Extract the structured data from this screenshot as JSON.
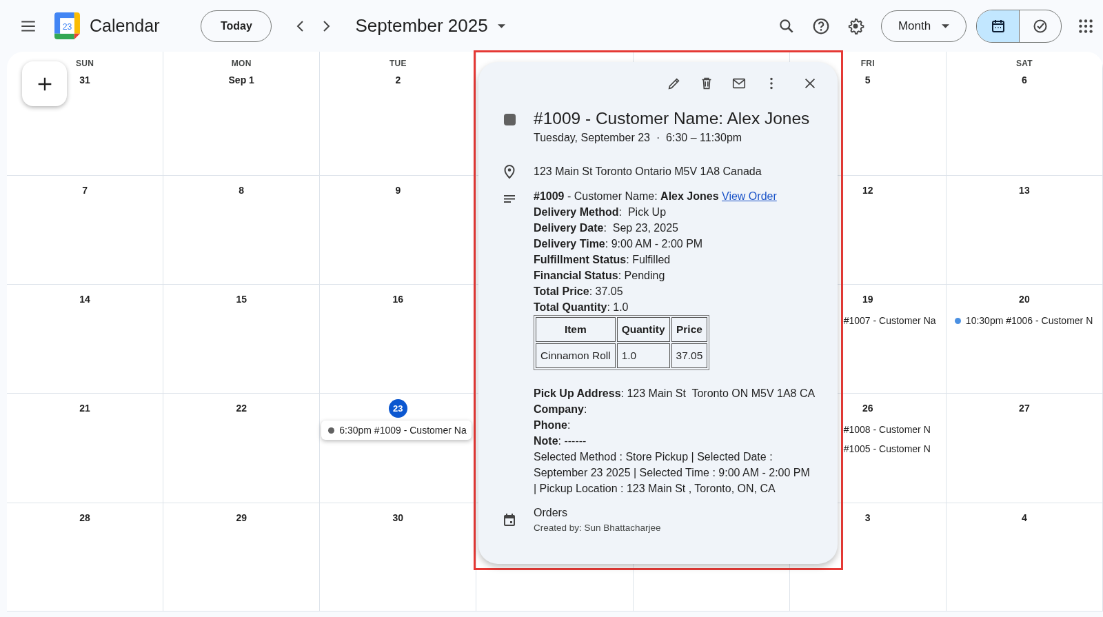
{
  "header": {
    "logo_number": "23",
    "app_title": "Calendar",
    "today_button": "Today",
    "period": "September 2025",
    "view_button": "Month",
    "actions": [
      {
        "kind": "search"
      },
      {
        "kind": "help"
      },
      {
        "kind": "settings"
      }
    ],
    "view_toggle": [
      {
        "kind": "calendar",
        "selected": true
      },
      {
        "kind": "tasks",
        "selected": false
      }
    ]
  },
  "weeks": [
    {
      "left_days": [
        {
          "weekday": "SUN",
          "date": "31"
        },
        {
          "weekday": "MON",
          "date": "Sep 1"
        },
        {
          "weekday": "TUE",
          "date": "2"
        }
      ],
      "right_days": [
        {
          "weekday": "FRI",
          "date": "5"
        },
        {
          "weekday": "SAT",
          "date": "6"
        }
      ]
    },
    {
      "left_days": [
        {
          "date": "7"
        },
        {
          "date": "8"
        },
        {
          "date": "9"
        }
      ],
      "right_days": [
        {
          "date": "12"
        },
        {
          "date": "13"
        }
      ]
    },
    {
      "left_days": [
        {
          "date": "14"
        },
        {
          "date": "15"
        },
        {
          "date": "16"
        }
      ],
      "right_days": [
        {
          "date": "19",
          "events": [
            {
              "kind": "cut",
              "selected": false,
              "text": "#1007 - Customer Na"
            }
          ]
        },
        {
          "date": "20",
          "events": [
            {
              "kind": "dot",
              "selected": false,
              "color": "#4a90e2",
              "time": "10:30pm",
              "text": "#1006 - Customer N"
            }
          ]
        }
      ]
    },
    {
      "left_days": [
        {
          "date": "21"
        },
        {
          "date": "22"
        },
        {
          "date": "23",
          "today": true,
          "events": [
            {
              "kind": "dot",
              "selected": true,
              "color": "#616161",
              "time": "6:30pm",
              "text": "#1009 - Customer Na"
            }
          ]
        }
      ],
      "right_days": [
        {
          "date": "26",
          "events": [
            {
              "kind": "cut",
              "selected": false,
              "text": "#1008 - Customer N"
            },
            {
              "kind": "cut",
              "selected": false,
              "text": "#1005 - Customer N"
            }
          ]
        },
        {
          "date": "27"
        }
      ]
    },
    {
      "left_days": [
        {
          "date": "28"
        },
        {
          "date": "29"
        },
        {
          "date": "30"
        }
      ],
      "right_days": [
        {
          "date": "3"
        },
        {
          "date": "4"
        }
      ]
    }
  ],
  "event_popup": {
    "actions": [
      {
        "kind": "edit"
      },
      {
        "kind": "delete"
      },
      {
        "kind": "email"
      },
      {
        "kind": "more"
      },
      {
        "kind": "close"
      }
    ],
    "title": "#1009 - Customer Name: Alex Jones",
    "color": "#616161",
    "when": "Tuesday, September 23  ·  6:30 – 11:30pm",
    "location": "123 Main St Toronto Ontario M5V 1A8 Canada",
    "description_first": {
      "text": "**#1009** - Customer Name: **Alex Jones**",
      "link": "View Order"
    },
    "description_lines": [
      "**Delivery Method**:  Pick Up",
      "**Delivery Date**:  Sep 23, 2025",
      "**Delivery Time**: 9:00 AM - 2:00 PM",
      "**Fulfillment Status**: Fulfilled",
      "**Financial Status**: Pending",
      "**Total Price**: 37.05",
      "**Total Quantity**: 1.0"
    ],
    "items_table": {
      "columns": [
        "Item",
        "Quantity",
        "Price"
      ],
      "rows": [
        [
          "Cinnamon Roll",
          "1.0",
          "37.05"
        ]
      ]
    },
    "address_lines": [
      "**Pick Up Address**: 123 Main St  Toronto ON M5V 1A8 CA",
      "**Company**:",
      "**Phone**:",
      "**Note**: ------"
    ],
    "note_text": "Selected Method : Store Pickup | Selected Date : September 23 2025 | Selected Time : 9:00 AM - 2:00 PM | Pickup Location : 123 Main St , Toronto, ON, CA",
    "calendar_name": "Orders",
    "created_by": "Created by: Sun Bhattacharjee"
  }
}
